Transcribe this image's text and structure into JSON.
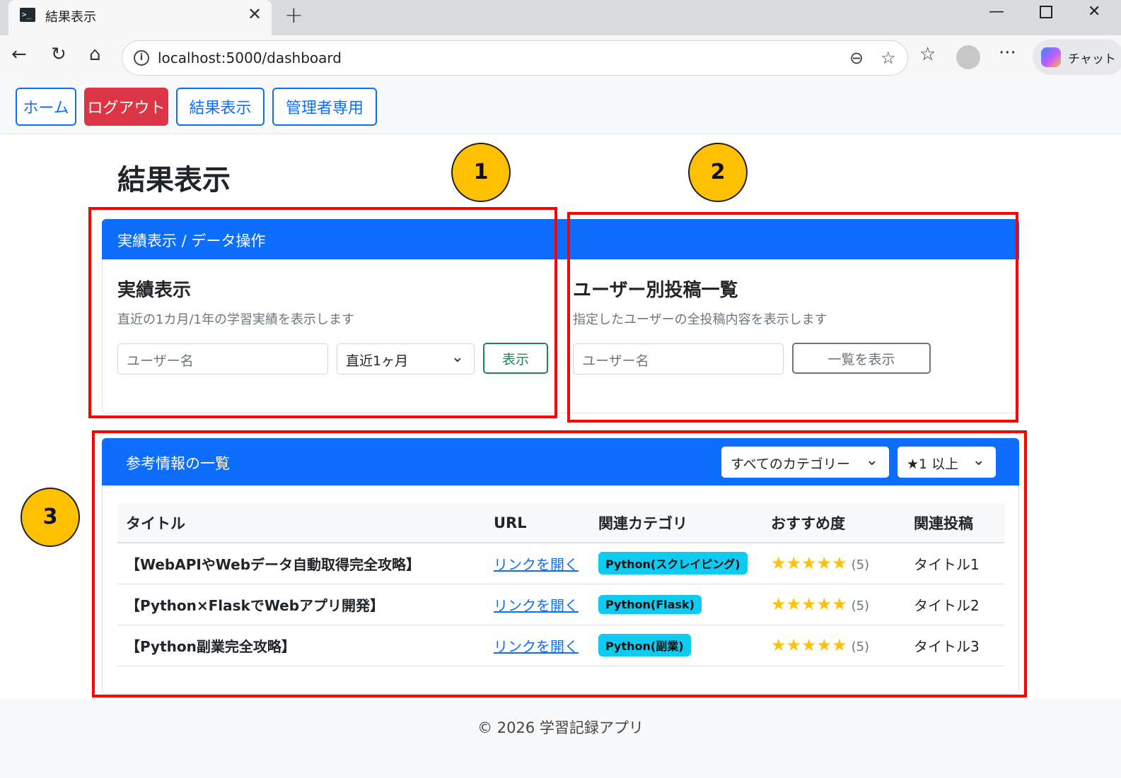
{
  "browser": {
    "tab_title": "結果表示",
    "tab_favicon": ">_",
    "url": "localhost:5000/dashboard",
    "chat_label": "チャット"
  },
  "nav": {
    "home": "ホーム",
    "logout": "ログアウト",
    "results": "結果表示",
    "admin": "管理者専用"
  },
  "page_title": "結果表示",
  "markers": [
    "1",
    "2",
    "3"
  ],
  "card1": {
    "header": "実績表示 / データ操作",
    "title": "実績表示",
    "description": "直近の1カ月/1年の学習実績を表示します",
    "username_placeholder": "ユーザー名",
    "period_selected": "直近1ヶ月",
    "submit_label": "表示"
  },
  "card2": {
    "title": "ユーザー別投稿一覧",
    "description": "指定したユーザーの全投稿内容を表示します",
    "username_placeholder": "ユーザー名",
    "submit_label": "一覧を表示"
  },
  "references": {
    "header": "参考情報の一覧",
    "category_filter": "すべてのカテゴリー",
    "rating_filter": "★1 以上",
    "columns": [
      "タイトル",
      "URL",
      "関連カテゴリ",
      "おすすめ度",
      "関連投稿"
    ],
    "rows": [
      {
        "title": "【WebAPIやWebデータ自動取得完全攻略】",
        "link": "リンクを開く",
        "category": "Python(スクレイピング)",
        "stars": "★★★★★",
        "count": "(5)",
        "related": "タイトル1"
      },
      {
        "title": "【Python×FlaskでWebアプリ開発】",
        "link": "リンクを開く",
        "category": "Python(Flask)",
        "stars": "★★★★★",
        "count": "(5)",
        "related": "タイトル2"
      },
      {
        "title": "【Python副業完全攻略】",
        "link": "リンクを開く",
        "category": "Python(副業)",
        "stars": "★★★★★",
        "count": "(5)",
        "related": "タイトル3"
      }
    ]
  },
  "footer": "© 2026 学習記録アプリ",
  "colors": {
    "primary": "#0d6efd",
    "danger": "#dc3545",
    "success": "#198754",
    "info_badge": "#0dcaf0",
    "star": "#ffc107",
    "marker": "#ffc000",
    "annotation_box": "#ff0000"
  }
}
